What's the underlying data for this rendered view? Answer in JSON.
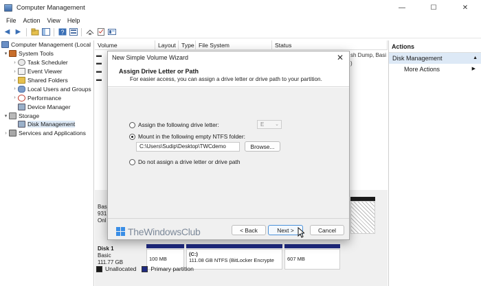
{
  "window": {
    "title": "Computer Management",
    "controls": {
      "minimize": "—",
      "maximize": "☐",
      "close": "✕"
    }
  },
  "menu": [
    "File",
    "Action",
    "View",
    "Help"
  ],
  "tree": {
    "root": "Computer Management (Local",
    "system_tools": "System Tools",
    "task_scheduler": "Task Scheduler",
    "event_viewer": "Event Viewer",
    "shared_folders": "Shared Folders",
    "local_users": "Local Users and Groups",
    "performance": "Performance",
    "device_manager": "Device Manager",
    "storage": "Storage",
    "disk_management": "Disk Management",
    "services": "Services and Applications"
  },
  "columns": [
    "Volume",
    "Layout",
    "Type",
    "File System",
    "Status"
  ],
  "right_status_text": [
    "sh Dump, Basi",
    ")"
  ],
  "disk_panel": {
    "disk0_lines": [
      "Basi",
      "931",
      "Onl"
    ],
    "disk1_name": "Disk 1",
    "disk1_lines": [
      "Basic",
      "111.77 GB"
    ],
    "part1": "100 MB",
    "part2_title": "(C:)",
    "part2_detail": "111.08 GB NTFS (BitLocker Encrypte",
    "part3": "607 MB"
  },
  "legend": {
    "unallocated": "Unallocated",
    "primary": "Primary partition"
  },
  "actions": {
    "title": "Actions",
    "section": "Disk Management",
    "more": "More Actions"
  },
  "dialog": {
    "title": "New Simple Volume Wizard",
    "heading": "Assign Drive Letter or Path",
    "description": "For easier access, you can assign a drive letter or drive path to your partition.",
    "option_letter": "Assign the following drive letter:",
    "drive_letter": "E",
    "option_mount": "Mount in the following empty NTFS folder:",
    "mount_path": "C:\\Users\\Sudip\\Desktop\\TWCdemo",
    "browse": "Browse...",
    "option_none": "Do not assign a drive letter or drive path",
    "back": "< Back",
    "next": "Next >",
    "cancel": "Cancel",
    "selected_option": "mount"
  },
  "watermark": "TheWindowsClub",
  "colors": {
    "primary_partition": "#1f2a80",
    "selection": "#dde9f6",
    "accent_border": "#4a90d9"
  }
}
